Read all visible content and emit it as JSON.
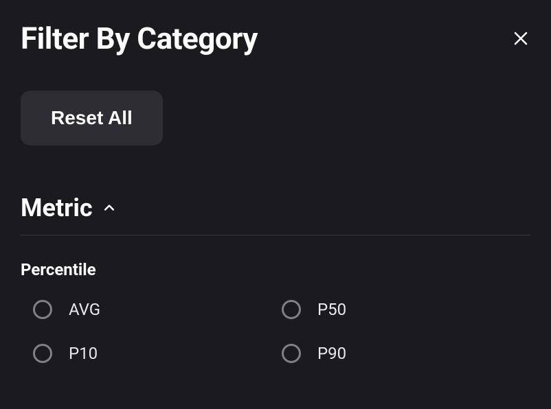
{
  "header": {
    "title": "Filter By Category"
  },
  "actions": {
    "reset_label": "Reset All"
  },
  "section": {
    "title": "Metric",
    "subsection_label": "Percentile",
    "options": {
      "opt0": "AVG",
      "opt1": "P50",
      "opt2": "P10",
      "opt3": "P90"
    }
  }
}
